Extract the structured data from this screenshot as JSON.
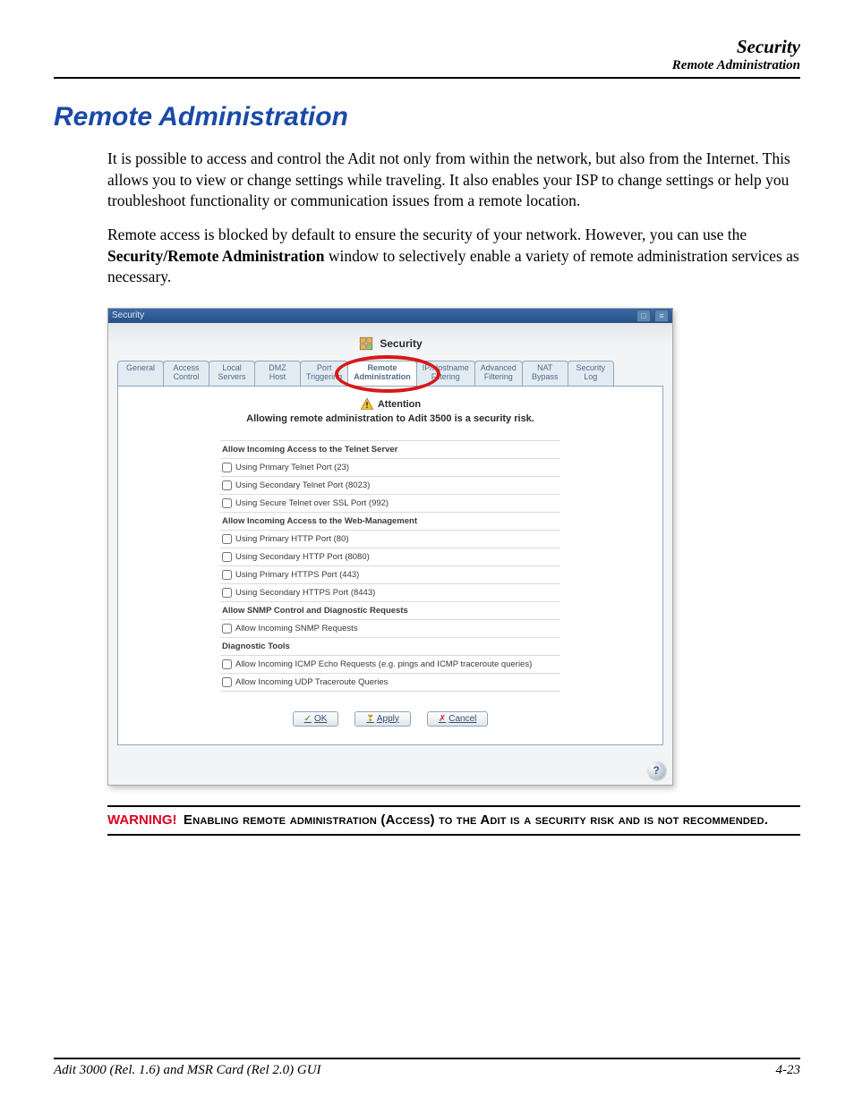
{
  "header": {
    "chapter": "Security",
    "breadcrumb": "Remote Administration"
  },
  "title": "Remote Administration",
  "paragraphs": {
    "p1": "It is possible to access and control the Adit not only from within the network, but also from the Internet. This allows you to view or change settings while traveling. It also enables your ISP to change settings or help you troubleshoot functionality or communication issues from a remote location.",
    "p2a": "Remote access is blocked by default to ensure the security of your network. However, you can use the ",
    "p2bold": "Security/Remote Administration",
    "p2b": " window to selectively enable a variety of remote administration services as necessary."
  },
  "shot": {
    "titlebar": "Security",
    "section_title": "Security",
    "tabs": [
      {
        "l1": "General",
        "l2": ""
      },
      {
        "l1": "Access",
        "l2": "Control"
      },
      {
        "l1": "Local",
        "l2": "Servers"
      },
      {
        "l1": "DMZ",
        "l2": "Host"
      },
      {
        "l1": "Port",
        "l2": "Triggering"
      },
      {
        "l1": "Remote",
        "l2": "Administration"
      },
      {
        "l1": "IP/Hostname",
        "l2": "Filtering"
      },
      {
        "l1": "Advanced",
        "l2": "Filtering"
      },
      {
        "l1": "NAT",
        "l2": "Bypass"
      },
      {
        "l1": "Security",
        "l2": "Log"
      }
    ],
    "active_tab_index": 5,
    "attention_label": "Attention",
    "attention_msg": "Allowing remote administration to Adit 3500 is a security risk.",
    "rows": [
      {
        "type": "header",
        "text": "Allow Incoming Access to the Telnet Server"
      },
      {
        "type": "check",
        "text": "Using Primary Telnet Port (23)"
      },
      {
        "type": "check",
        "text": "Using Secondary Telnet Port (8023)"
      },
      {
        "type": "check",
        "text": "Using Secure Telnet over SSL Port (992)"
      },
      {
        "type": "header",
        "text": "Allow Incoming Access to the Web-Management"
      },
      {
        "type": "check",
        "text": "Using Primary HTTP Port (80)"
      },
      {
        "type": "check",
        "text": "Using Secondary HTTP Port (8080)"
      },
      {
        "type": "check",
        "text": "Using Primary HTTPS Port (443)"
      },
      {
        "type": "check",
        "text": "Using Secondary HTTPS Port (8443)"
      },
      {
        "type": "header",
        "text": "Allow SNMP Control and Diagnostic Requests"
      },
      {
        "type": "check",
        "text": "Allow Incoming SNMP Requests"
      },
      {
        "type": "header",
        "text": "Diagnostic Tools"
      },
      {
        "type": "check",
        "text": "Allow Incoming ICMP Echo Requests (e.g. pings and ICMP traceroute queries)"
      },
      {
        "type": "check",
        "text": "Allow Incoming UDP Traceroute Queries"
      }
    ],
    "buttons": {
      "ok": "OK",
      "apply": "Apply",
      "cancel": "Cancel"
    }
  },
  "warning": {
    "label": "WARNING!",
    "text": "Enabling remote administration (Access) to the Adit is a security risk and is not recommended."
  },
  "footer": {
    "left": "Adit 3000 (Rel. 1.6) and MSR Card (Rel 2.0) GUI",
    "right": "4-23"
  }
}
